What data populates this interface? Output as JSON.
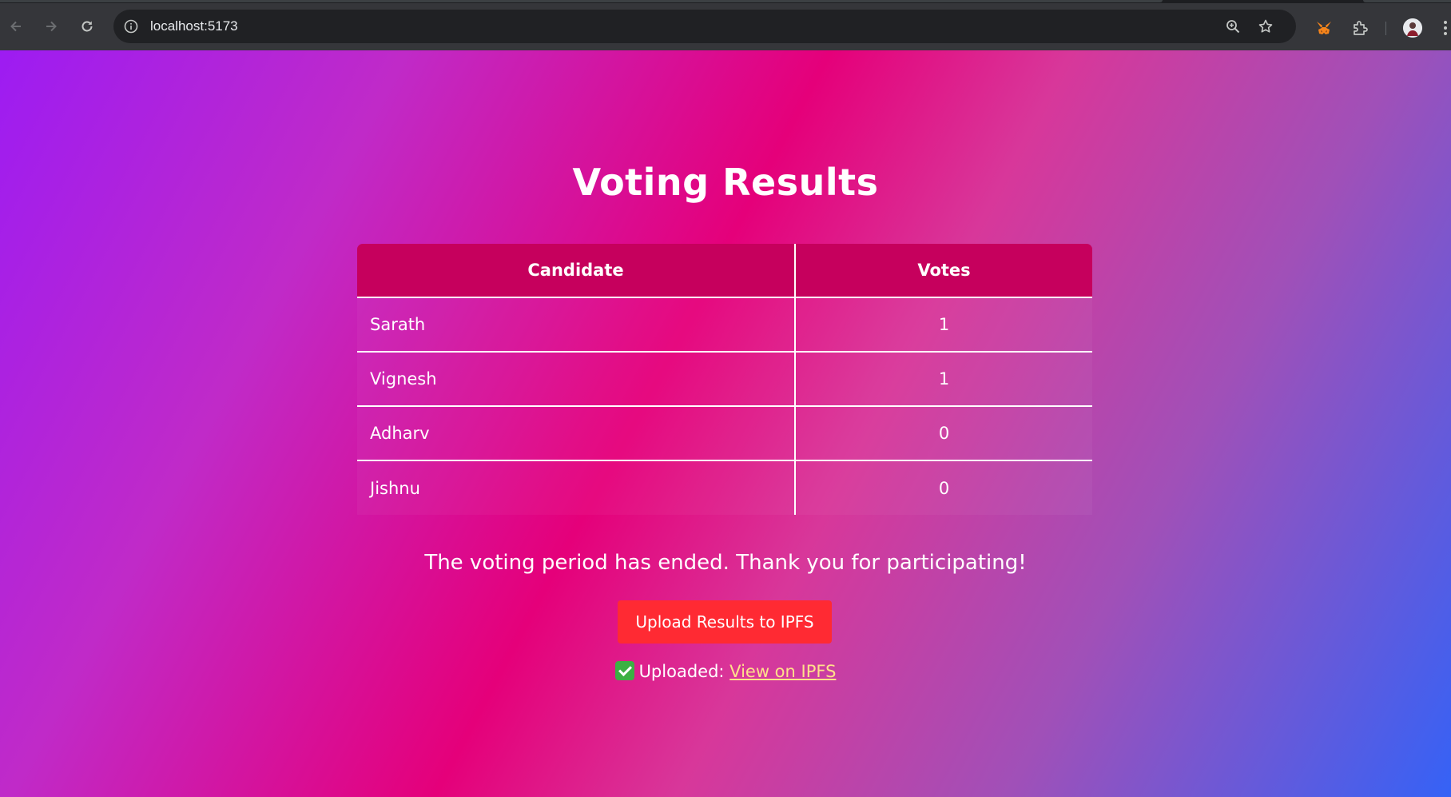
{
  "browser": {
    "url": "localhost:5173"
  },
  "page": {
    "title": "Voting Results",
    "table": {
      "headers": [
        "Candidate",
        "Votes"
      ],
      "rows": [
        {
          "candidate": "Sarath",
          "votes": "1"
        },
        {
          "candidate": "Vignesh",
          "votes": "1"
        },
        {
          "candidate": "Adharv",
          "votes": "0"
        },
        {
          "candidate": "Jishnu",
          "votes": "0"
        }
      ]
    },
    "status_message": "The voting period has ended. Thank you for participating!",
    "upload_button_label": "Upload Results to IPFS",
    "upload_status_label": "Uploaded:",
    "upload_link_text": "View on IPFS"
  },
  "colors": {
    "header_cell": "#c6005d",
    "upload_button": "#ff2a33",
    "link": "#ffe08a"
  }
}
